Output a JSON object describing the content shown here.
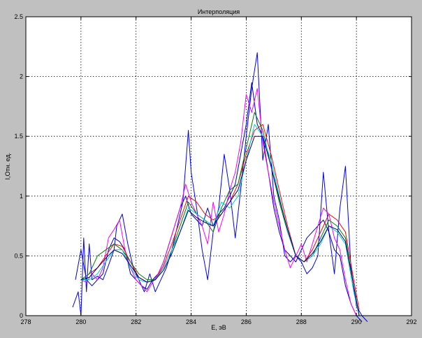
{
  "chart_data": {
    "type": "line",
    "title": "Интерполяция",
    "xlabel": "E, эВ",
    "ylabel": "I,Отн. ед.",
    "xlim": [
      278,
      292
    ],
    "ylim": [
      0,
      2.5
    ],
    "xticks": [
      278,
      280,
      282,
      284,
      286,
      288,
      290,
      292
    ],
    "yticks": [
      0,
      0.5,
      1,
      1.5,
      2,
      2.5
    ],
    "xtick_labels": [
      "278",
      "280",
      "282",
      "284",
      "286",
      "288",
      "290",
      "292"
    ],
    "ytick_labels": [
      "0",
      "0.5",
      "1",
      "1.5",
      "2",
      "2.5"
    ],
    "grid": true,
    "series": [
      {
        "color": "#0000ff",
        "x": [
          279.7,
          279.9,
          280.0,
          280.1,
          280.2,
          280.3,
          280.4,
          280.6,
          280.8,
          281.0,
          281.2,
          281.3,
          281.5,
          281.7,
          281.9,
          282.1,
          282.3,
          282.5,
          282.7,
          282.9,
          283.1,
          283.3,
          283.5,
          283.7,
          283.9,
          284.0,
          284.2,
          284.4,
          284.6,
          284.8,
          285.0,
          285.2,
          285.4,
          285.6,
          285.8,
          286.0,
          286.2,
          286.4,
          286.6,
          286.8,
          287.0,
          287.2,
          287.4,
          287.6,
          287.8,
          288.0,
          288.2,
          288.4,
          288.6,
          288.8,
          289.0,
          289.2,
          289.4,
          289.6,
          289.8,
          290.0,
          290.2,
          290.4
        ],
        "y": [
          0.07,
          0.2,
          0.0,
          0.65,
          0.2,
          0.6,
          0.3,
          0.33,
          0.3,
          0.42,
          0.55,
          0.75,
          0.85,
          0.6,
          0.4,
          0.3,
          0.2,
          0.35,
          0.2,
          0.3,
          0.4,
          0.55,
          0.75,
          0.95,
          1.55,
          1.2,
          0.9,
          0.55,
          0.3,
          0.7,
          0.9,
          1.35,
          1.05,
          0.65,
          1.05,
          1.5,
          1.9,
          2.2,
          1.3,
          1.6,
          1.0,
          0.8,
          0.5,
          0.45,
          0.5,
          0.45,
          0.35,
          0.4,
          0.5,
          1.2,
          0.7,
          0.35,
          0.9,
          1.25,
          0.4,
          0.08,
          0.0,
          -0.05
        ]
      },
      {
        "color": "#0000cc",
        "x": [
          279.8,
          280.0,
          280.2,
          280.4,
          280.6,
          280.8,
          281.0,
          281.2,
          281.4,
          281.6,
          281.8,
          282.0,
          282.2,
          282.4,
          282.6,
          282.8,
          283.0,
          283.2,
          283.4,
          283.6,
          283.8,
          284.0,
          284.2,
          284.4,
          284.6,
          284.8,
          285.0,
          285.2,
          285.4,
          285.6,
          285.8,
          286.0,
          286.2,
          286.4,
          286.6,
          286.8,
          287.0,
          287.2,
          287.4,
          287.6,
          287.8,
          288.0,
          288.2,
          288.4,
          288.6,
          288.8,
          289.0,
          289.2,
          289.4,
          289.6,
          289.8,
          290.0,
          290.2
        ],
        "y": [
          0.3,
          0.55,
          0.3,
          0.25,
          0.3,
          0.35,
          0.55,
          0.65,
          0.62,
          0.55,
          0.35,
          0.3,
          0.25,
          0.22,
          0.3,
          0.35,
          0.45,
          0.6,
          0.75,
          0.9,
          1.0,
          0.85,
          0.8,
          0.75,
          0.9,
          0.75,
          0.85,
          0.9,
          1.0,
          1.1,
          1.35,
          1.6,
          1.95,
          1.6,
          1.5,
          1.2,
          0.9,
          0.7,
          0.55,
          0.5,
          0.45,
          0.55,
          0.65,
          0.7,
          0.75,
          0.8,
          0.7,
          0.55,
          0.5,
          0.25,
          0.1,
          0.0,
          -0.05
        ]
      },
      {
        "color": "#ff00ff",
        "x": [
          280.0,
          280.2,
          280.4,
          280.6,
          280.8,
          281.0,
          281.2,
          281.4,
          281.6,
          281.8,
          282.0,
          282.2,
          282.4,
          282.6,
          282.8,
          283.0,
          283.2,
          283.4,
          283.6,
          283.8,
          284.0,
          284.2,
          284.4,
          284.6,
          284.8,
          285.0,
          285.2,
          285.4,
          285.6,
          285.8,
          286.0,
          286.2,
          286.4,
          286.6,
          286.8,
          287.0,
          287.2,
          287.4,
          287.6,
          287.8,
          288.0,
          288.2,
          288.4,
          288.6,
          288.8,
          289.0,
          289.2,
          289.4,
          289.6,
          289.8,
          290.0
        ],
        "y": [
          0.3,
          0.28,
          0.35,
          0.3,
          0.4,
          0.65,
          0.72,
          0.8,
          0.55,
          0.4,
          0.3,
          0.25,
          0.2,
          0.28,
          0.35,
          0.45,
          0.6,
          0.75,
          0.9,
          1.1,
          0.95,
          0.85,
          0.75,
          0.6,
          0.95,
          0.7,
          0.85,
          1.05,
          1.2,
          1.45,
          1.85,
          1.7,
          1.9,
          1.45,
          1.2,
          0.95,
          0.75,
          0.55,
          0.4,
          0.5,
          0.6,
          0.45,
          0.6,
          0.75,
          0.9,
          0.85,
          0.65,
          0.55,
          0.3,
          0.1,
          0.0
        ]
      },
      {
        "color": "#ff0000",
        "x": [
          280.0,
          280.3,
          280.6,
          280.9,
          281.2,
          281.5,
          281.8,
          282.1,
          282.4,
          282.7,
          283.0,
          283.3,
          283.6,
          283.9,
          284.2,
          284.5,
          284.8,
          285.1,
          285.4,
          285.7,
          286.0,
          286.3,
          286.6,
          286.9,
          287.2,
          287.5,
          287.8,
          288.1,
          288.4,
          288.7,
          289.0,
          289.3,
          289.6,
          289.9,
          290.1
        ],
        "y": [
          0.3,
          0.35,
          0.4,
          0.5,
          0.6,
          0.58,
          0.45,
          0.32,
          0.28,
          0.3,
          0.42,
          0.6,
          0.8,
          1.0,
          0.95,
          0.85,
          0.8,
          0.85,
          0.95,
          1.1,
          1.35,
          1.55,
          1.6,
          1.35,
          1.05,
          0.75,
          0.5,
          0.45,
          0.55,
          0.7,
          0.85,
          0.8,
          0.7,
          0.3,
          0.05
        ]
      },
      {
        "color": "#008000",
        "x": [
          280.0,
          280.3,
          280.6,
          280.9,
          281.2,
          281.5,
          281.8,
          282.1,
          282.4,
          282.7,
          283.0,
          283.3,
          283.6,
          283.9,
          284.2,
          284.5,
          284.8,
          285.1,
          285.4,
          285.7,
          286.0,
          286.3,
          286.6,
          286.9,
          287.2,
          287.5,
          287.8,
          288.1,
          288.4,
          288.7,
          289.0,
          289.3,
          289.6,
          289.9,
          290.1
        ],
        "y": [
          0.3,
          0.35,
          0.5,
          0.55,
          0.6,
          0.55,
          0.45,
          0.35,
          0.3,
          0.3,
          0.4,
          0.55,
          0.75,
          0.95,
          0.85,
          0.8,
          0.7,
          0.9,
          1.05,
          1.1,
          1.4,
          1.7,
          1.55,
          1.25,
          0.95,
          0.7,
          0.5,
          0.45,
          0.5,
          0.65,
          0.8,
          0.75,
          0.65,
          0.25,
          0.0
        ]
      },
      {
        "color": "#00cccc",
        "x": [
          280.0,
          280.3,
          280.6,
          280.9,
          281.2,
          281.5,
          281.8,
          282.1,
          282.4,
          282.7,
          283.0,
          283.3,
          283.6,
          283.9,
          284.2,
          284.5,
          284.8,
          285.1,
          285.4,
          285.7,
          286.0,
          286.3,
          286.6,
          286.9,
          287.2,
          287.5,
          287.8,
          288.1,
          288.4,
          288.7,
          289.0,
          289.3,
          289.6,
          289.9,
          290.1
        ],
        "y": [
          0.3,
          0.3,
          0.35,
          0.45,
          0.55,
          0.55,
          0.4,
          0.3,
          0.28,
          0.3,
          0.4,
          0.55,
          0.7,
          0.9,
          0.85,
          0.8,
          0.75,
          0.95,
          0.9,
          1.0,
          1.3,
          1.6,
          1.5,
          1.3,
          1.0,
          0.7,
          0.5,
          0.45,
          0.5,
          0.6,
          0.75,
          0.7,
          0.6,
          0.2,
          0.0
        ]
      },
      {
        "color": "#000080",
        "x": [
          280.0,
          280.3,
          280.6,
          280.9,
          281.2,
          281.5,
          281.8,
          282.1,
          282.4,
          282.7,
          283.0,
          283.3,
          283.6,
          283.9,
          284.2,
          284.5,
          284.8,
          285.1,
          285.4,
          285.7,
          286.0,
          286.3,
          286.6,
          286.9,
          287.2,
          287.5,
          287.8,
          288.1,
          288.4,
          288.7,
          289.0,
          289.3,
          289.6,
          289.9,
          290.1
        ],
        "y": [
          0.3,
          0.32,
          0.4,
          0.48,
          0.55,
          0.52,
          0.42,
          0.32,
          0.28,
          0.3,
          0.38,
          0.52,
          0.7,
          0.88,
          0.82,
          0.78,
          0.75,
          0.85,
          0.95,
          1.05,
          1.3,
          1.5,
          1.5,
          1.25,
          0.98,
          0.72,
          0.5,
          0.45,
          0.52,
          0.62,
          0.75,
          0.72,
          0.62,
          0.25,
          0.0
        ]
      }
    ]
  }
}
